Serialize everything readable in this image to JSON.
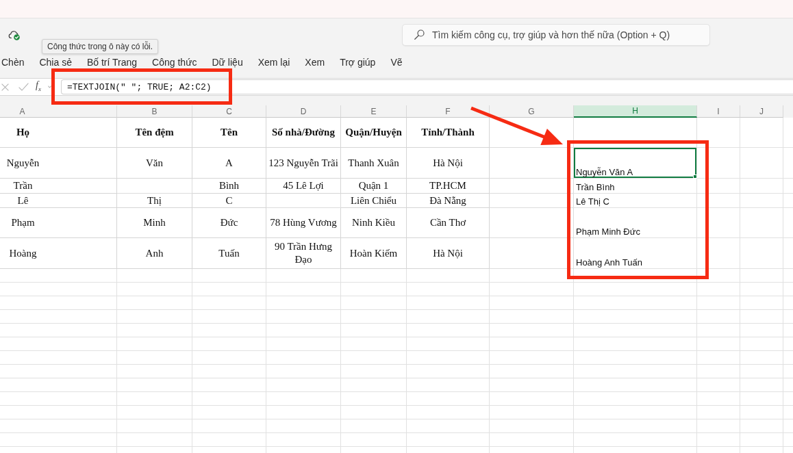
{
  "toolbar": {
    "search": {
      "placeholder": "Tìm kiếm công cụ, trợ giúp và hơn thế nữa (Option + Q)"
    }
  },
  "tooltip": {
    "text": "Công thức trong ô này có lỗi."
  },
  "ribbon_tabs": [
    "Chèn",
    "Chia sẻ",
    "Bố trí Trang",
    "Công thức",
    "Dữ liệu",
    "Xem lại",
    "Xem",
    "Trợ giúp",
    "Vẽ"
  ],
  "formula_bar": {
    "function_button": "f$_{x}$",
    "value": "=TEXTJOIN(\" \"; TRUE; A2:C2)"
  },
  "sheet": {
    "columns": [
      {
        "label": "A",
        "selected": false
      },
      {
        "label": "B",
        "selected": false
      },
      {
        "label": "C",
        "selected": false
      },
      {
        "label": "D",
        "selected": false
      },
      {
        "label": "E",
        "selected": false
      },
      {
        "label": "F",
        "selected": false
      },
      {
        "label": "G",
        "selected": false
      },
      {
        "label": "H",
        "selected": true
      },
      {
        "label": "I",
        "selected": false
      },
      {
        "label": "J",
        "selected": false
      }
    ],
    "rows": [
      {
        "kind": "header",
        "cells": [
          {
            "kind": "text",
            "text": "Họ",
            "selected": false
          },
          {
            "kind": "text",
            "text": "Tên đệm",
            "selected": false
          },
          {
            "kind": "text",
            "text": "Tên",
            "selected": false
          },
          {
            "kind": "text",
            "text": "Số nhà/Đường",
            "selected": false
          },
          {
            "kind": "text",
            "text": "Quận/Huyện",
            "selected": false
          },
          {
            "kind": "text",
            "text": "Tỉnh/Thành",
            "selected": false
          },
          {
            "kind": "empty",
            "selected": false
          },
          {
            "kind": "empty",
            "selected": false
          }
        ]
      },
      {
        "kind": "data",
        "cells": [
          {
            "kind": "text",
            "text": "Nguyễn",
            "selected": false
          },
          {
            "kind": "text",
            "text": "Văn",
            "selected": false
          },
          {
            "kind": "text",
            "text": "A",
            "selected": false
          },
          {
            "kind": "text",
            "text": "123 Nguyễn Trãi",
            "selected": false
          },
          {
            "kind": "text",
            "text": "Thanh Xuân",
            "selected": false
          },
          {
            "kind": "text",
            "text": "Hà Nội",
            "selected": false
          },
          {
            "kind": "empty",
            "selected": false
          },
          {
            "kind": "formula",
            "text": "Nguyễn Văn A",
            "selected": true
          }
        ]
      },
      {
        "kind": "data",
        "cells": [
          {
            "kind": "text",
            "text": "Trần",
            "selected": false
          },
          {
            "kind": "empty",
            "selected": false
          },
          {
            "kind": "text",
            "text": "Bình",
            "selected": false
          },
          {
            "kind": "text",
            "text": "45 Lê Lợi",
            "selected": false
          },
          {
            "kind": "text",
            "text": "Quận 1",
            "selected": false
          },
          {
            "kind": "text",
            "text": "TP.HCM",
            "selected": false
          },
          {
            "kind": "empty",
            "selected": false
          },
          {
            "kind": "formula",
            "text": "Trần Bình",
            "selected": false
          }
        ]
      },
      {
        "kind": "data",
        "cells": [
          {
            "kind": "text",
            "text": "Lê",
            "selected": false
          },
          {
            "kind": "text",
            "text": "Thị",
            "selected": false
          },
          {
            "kind": "text",
            "text": "C",
            "selected": false
          },
          {
            "kind": "empty",
            "selected": false
          },
          {
            "kind": "text",
            "text": "Liên Chiểu",
            "selected": false
          },
          {
            "kind": "text",
            "text": "Đà Nẵng",
            "selected": false
          },
          {
            "kind": "empty",
            "selected": false
          },
          {
            "kind": "formula",
            "text": "Lê Thị C",
            "selected": false
          }
        ]
      },
      {
        "kind": "data",
        "cells": [
          {
            "kind": "text",
            "text": "Phạm",
            "selected": false
          },
          {
            "kind": "text",
            "text": "Minh",
            "selected": false
          },
          {
            "kind": "text",
            "text": "Đức",
            "selected": false
          },
          {
            "kind": "text",
            "text": "78 Hùng Vương",
            "selected": false
          },
          {
            "kind": "text",
            "text": "Ninh Kiều",
            "selected": false
          },
          {
            "kind": "text",
            "text": "Cần Thơ",
            "selected": false
          },
          {
            "kind": "empty",
            "selected": false
          },
          {
            "kind": "formula",
            "text": "Phạm Minh Đức",
            "selected": false
          }
        ]
      },
      {
        "kind": "data",
        "cells": [
          {
            "kind": "text",
            "text": "Hoàng",
            "selected": false
          },
          {
            "kind": "text",
            "text": "Anh",
            "selected": false
          },
          {
            "kind": "text",
            "text": "Tuấn",
            "selected": false
          },
          {
            "kind": "text",
            "text": "90 Trần Hưng Đạo",
            "selected": false
          },
          {
            "kind": "text",
            "text": "Hoàn Kiếm",
            "selected": false
          },
          {
            "kind": "text",
            "text": "Hà Nội",
            "selected": false
          },
          {
            "kind": "empty",
            "selected": false
          },
          {
            "kind": "formula",
            "text": "Hoàng Anh Tuấn",
            "selected": false
          }
        ]
      }
    ]
  },
  "annotations": [
    {
      "kind": "frame"
    },
    {
      "kind": "arrow"
    },
    {
      "kind": "frame"
    }
  ]
}
